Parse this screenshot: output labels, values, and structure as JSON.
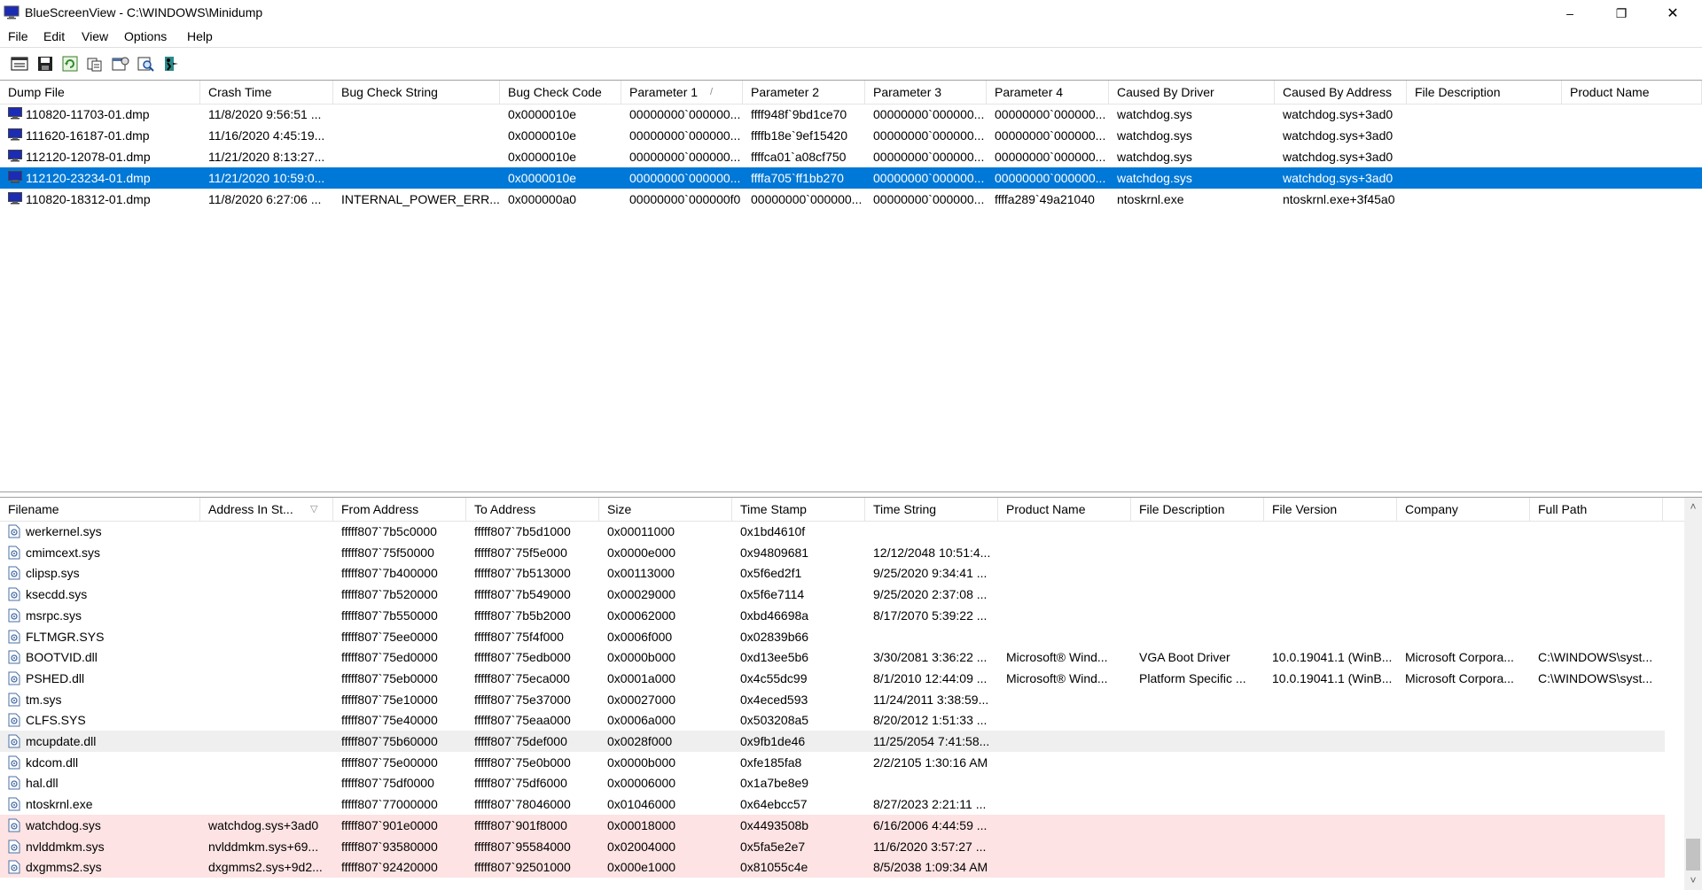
{
  "window": {
    "title": "BlueScreenView - C:\\WINDOWS\\Minidump",
    "minimize": "–",
    "maximize": "❐",
    "close": "✕"
  },
  "menu": [
    "File",
    "Edit",
    "View",
    "Options",
    "Help"
  ],
  "toolbar": [
    "html-report-icon",
    "save-icon",
    "refresh-icon",
    "copy-icon",
    "properties-icon",
    "find-icon",
    "exit-icon"
  ],
  "dumps": {
    "columns": [
      "Dump File",
      "Crash Time",
      "Bug Check String",
      "Bug Check Code",
      "Parameter 1",
      "Parameter 2",
      "Parameter 3",
      "Parameter 4",
      "Caused By Driver",
      "Caused By Address",
      "File Description",
      "Product Name"
    ],
    "sort_indicator": "/",
    "selected_index": 3,
    "rows": [
      [
        "110820-11703-01.dmp",
        "11/8/2020 9:56:51 ...",
        "",
        "0x0000010e",
        "00000000`000000...",
        "ffff948f`9bd1ce70",
        "00000000`000000...",
        "00000000`000000...",
        "watchdog.sys",
        "watchdog.sys+3ad0",
        "",
        ""
      ],
      [
        "111620-16187-01.dmp",
        "11/16/2020 4:45:19...",
        "",
        "0x0000010e",
        "00000000`000000...",
        "ffffb18e`9ef15420",
        "00000000`000000...",
        "00000000`000000...",
        "watchdog.sys",
        "watchdog.sys+3ad0",
        "",
        ""
      ],
      [
        "112120-12078-01.dmp",
        "11/21/2020 8:13:27...",
        "",
        "0x0000010e",
        "00000000`000000...",
        "ffffca01`a08cf750",
        "00000000`000000...",
        "00000000`000000...",
        "watchdog.sys",
        "watchdog.sys+3ad0",
        "",
        ""
      ],
      [
        "112120-23234-01.dmp",
        "11/21/2020 10:59:0...",
        "",
        "0x0000010e",
        "00000000`000000...",
        "ffffa705`ff1bb270",
        "00000000`000000...",
        "00000000`000000...",
        "watchdog.sys",
        "watchdog.sys+3ad0",
        "",
        ""
      ],
      [
        "110820-18312-01.dmp",
        "11/8/2020 6:27:06 ...",
        "INTERNAL_POWER_ERR...",
        "0x000000a0",
        "00000000`000000f0",
        "00000000`000000...",
        "00000000`000000...",
        "ffffa289`49a21040",
        "ntoskrnl.exe",
        "ntoskrnl.exe+3f45a0",
        "",
        ""
      ]
    ]
  },
  "drivers": {
    "columns": [
      "Filename",
      "Address In St...",
      "From Address",
      "To Address",
      "Size",
      "Time Stamp",
      "Time String",
      "Product Name",
      "File Description",
      "File Version",
      "Company",
      "Full Path"
    ],
    "sort_indicator": "▽",
    "rows": [
      [
        "werkernel.sys",
        "",
        "fffff807`7b5c0000",
        "fffff807`7b5d1000",
        "0x00011000",
        "0x1bd4610f",
        "",
        "",
        "",
        "",
        "",
        ""
      ],
      [
        "cmimcext.sys",
        "",
        "fffff807`75f50000",
        "fffff807`75f5e000",
        "0x0000e000",
        "0x94809681",
        "12/12/2048 10:51:4...",
        "",
        "",
        "",
        "",
        ""
      ],
      [
        "clipsp.sys",
        "",
        "fffff807`7b400000",
        "fffff807`7b513000",
        "0x00113000",
        "0x5f6ed2f1",
        "9/25/2020 9:34:41 ...",
        "",
        "",
        "",
        "",
        ""
      ],
      [
        "ksecdd.sys",
        "",
        "fffff807`7b520000",
        "fffff807`7b549000",
        "0x00029000",
        "0x5f6e7114",
        "9/25/2020 2:37:08 ...",
        "",
        "",
        "",
        "",
        ""
      ],
      [
        "msrpc.sys",
        "",
        "fffff807`7b550000",
        "fffff807`7b5b2000",
        "0x00062000",
        "0xbd46698a",
        "8/17/2070 5:39:22 ...",
        "",
        "",
        "",
        "",
        ""
      ],
      [
        "FLTMGR.SYS",
        "",
        "fffff807`75ee0000",
        "fffff807`75f4f000",
        "0x0006f000",
        "0x02839b66",
        "",
        "",
        "",
        "",
        "",
        ""
      ],
      [
        "BOOTVID.dll",
        "",
        "fffff807`75ed0000",
        "fffff807`75edb000",
        "0x0000b000",
        "0xd13ee5b6",
        "3/30/2081 3:36:22 ...",
        "Microsoft® Wind...",
        "VGA Boot Driver",
        "10.0.19041.1 (WinB...",
        "Microsoft Corpora...",
        "C:\\WINDOWS\\syst..."
      ],
      [
        "PSHED.dll",
        "",
        "fffff807`75eb0000",
        "fffff807`75eca000",
        "0x0001a000",
        "0x4c55dc99",
        "8/1/2010 12:44:09 ...",
        "Microsoft® Wind...",
        "Platform Specific ...",
        "10.0.19041.1 (WinB...",
        "Microsoft Corpora...",
        "C:\\WINDOWS\\syst..."
      ],
      [
        "tm.sys",
        "",
        "fffff807`75e10000",
        "fffff807`75e37000",
        "0x00027000",
        "0x4eced593",
        "11/24/2011 3:38:59...",
        "",
        "",
        "",
        "",
        ""
      ],
      [
        "CLFS.SYS",
        "",
        "fffff807`75e40000",
        "fffff807`75eaa000",
        "0x0006a000",
        "0x503208a5",
        "8/20/2012 1:51:33 ...",
        "",
        "",
        "",
        "",
        ""
      ],
      [
        "mcupdate.dll",
        "",
        "fffff807`75b60000",
        "fffff807`75def000",
        "0x0028f000",
        "0x9fb1de46",
        "11/25/2054 7:41:58...",
        "",
        "",
        "",
        "",
        ""
      ],
      [
        "kdcom.dll",
        "",
        "fffff807`75e00000",
        "fffff807`75e0b000",
        "0x0000b000",
        "0xfe185fa8",
        "2/2/2105 1:30:16 AM",
        "",
        "",
        "",
        "",
        ""
      ],
      [
        "hal.dll",
        "",
        "fffff807`75df0000",
        "fffff807`75df6000",
        "0x00006000",
        "0x1a7be8e9",
        "",
        "",
        "",
        "",
        "",
        ""
      ],
      [
        "ntoskrnl.exe",
        "",
        "fffff807`77000000",
        "fffff807`78046000",
        "0x01046000",
        "0x64ebcc57",
        "8/27/2023 2:21:11 ...",
        "",
        "",
        "",
        "",
        ""
      ],
      [
        "watchdog.sys",
        "watchdog.sys+3ad0",
        "fffff807`901e0000",
        "fffff807`901f8000",
        "0x00018000",
        "0x4493508b",
        "6/16/2006 4:44:59 ...",
        "",
        "",
        "",
        "",
        ""
      ],
      [
        "nvlddmkm.sys",
        "nvlddmkm.sys+69...",
        "fffff807`93580000",
        "fffff807`95584000",
        "0x02004000",
        "0x5fa5e2e7",
        "11/6/2020 3:57:27 ...",
        "",
        "",
        "",
        "",
        ""
      ],
      [
        "dxgmms2.sys",
        "dxgmms2.sys+9d2...",
        "fffff807`92420000",
        "fffff807`92501000",
        "0x000e1000",
        "0x81055c4e",
        "8/5/2038 1:09:34 AM",
        "",
        "",
        "",
        "",
        ""
      ]
    ],
    "highlight_rows": [
      14,
      15,
      16
    ],
    "hover_row": 10
  },
  "scroll": {
    "left_arrow": "<",
    "right_arrow": ">",
    "up_arrow": "˄",
    "down_arrow": "˅"
  }
}
